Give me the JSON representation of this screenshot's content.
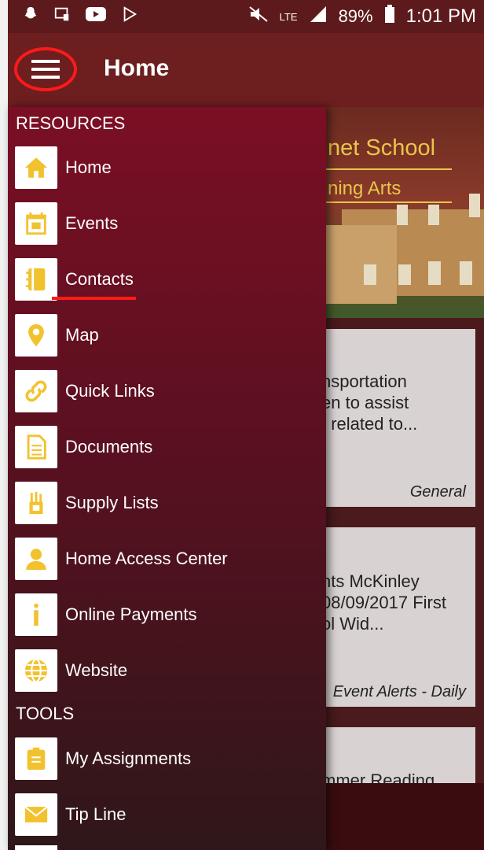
{
  "status_bar": {
    "battery": "89%",
    "time": "1:01 PM",
    "network": "LTE"
  },
  "app_bar": {
    "title": "Home"
  },
  "drawer": {
    "sections": [
      {
        "label": "RESOURCES",
        "items": [
          {
            "label": "Home",
            "icon": "home-icon"
          },
          {
            "label": "Events",
            "icon": "calendar-icon"
          },
          {
            "label": "Contacts",
            "icon": "address-book-icon"
          },
          {
            "label": "Map",
            "icon": "map-pin-icon"
          },
          {
            "label": "Quick Links",
            "icon": "link-icon"
          },
          {
            "label": "Documents",
            "icon": "document-icon"
          },
          {
            "label": "Supply Lists",
            "icon": "supplies-icon"
          },
          {
            "label": "Home Access Center",
            "icon": "person-icon"
          },
          {
            "label": "Online Payments",
            "icon": "info-icon"
          },
          {
            "label": "Website",
            "icon": "globe-icon"
          }
        ]
      },
      {
        "label": "TOOLS",
        "items": [
          {
            "label": "My Assignments",
            "icon": "clipboard-icon"
          },
          {
            "label": "Tip Line",
            "icon": "envelope-icon"
          }
        ]
      }
    ]
  },
  "background": {
    "banner_school": "net School",
    "banner_arts": "ning Arts",
    "cards": [
      {
        "lines": [
          "nsportation",
          "en to assist",
          "; related to..."
        ],
        "category": "General"
      },
      {
        "lines": [
          "nts McKinley",
          "08/09/2017 First",
          "ol Wid..."
        ],
        "category": "Event Alerts - Daily"
      },
      {
        "lines": [
          "mmer Reading"
        ],
        "category": ""
      }
    ]
  },
  "colors": {
    "icon_yellow": "#f2c22e",
    "drawer_top": "#7b0f24",
    "app_bar": "#6d1e1f",
    "annotation_red": "#ff1a1a"
  }
}
